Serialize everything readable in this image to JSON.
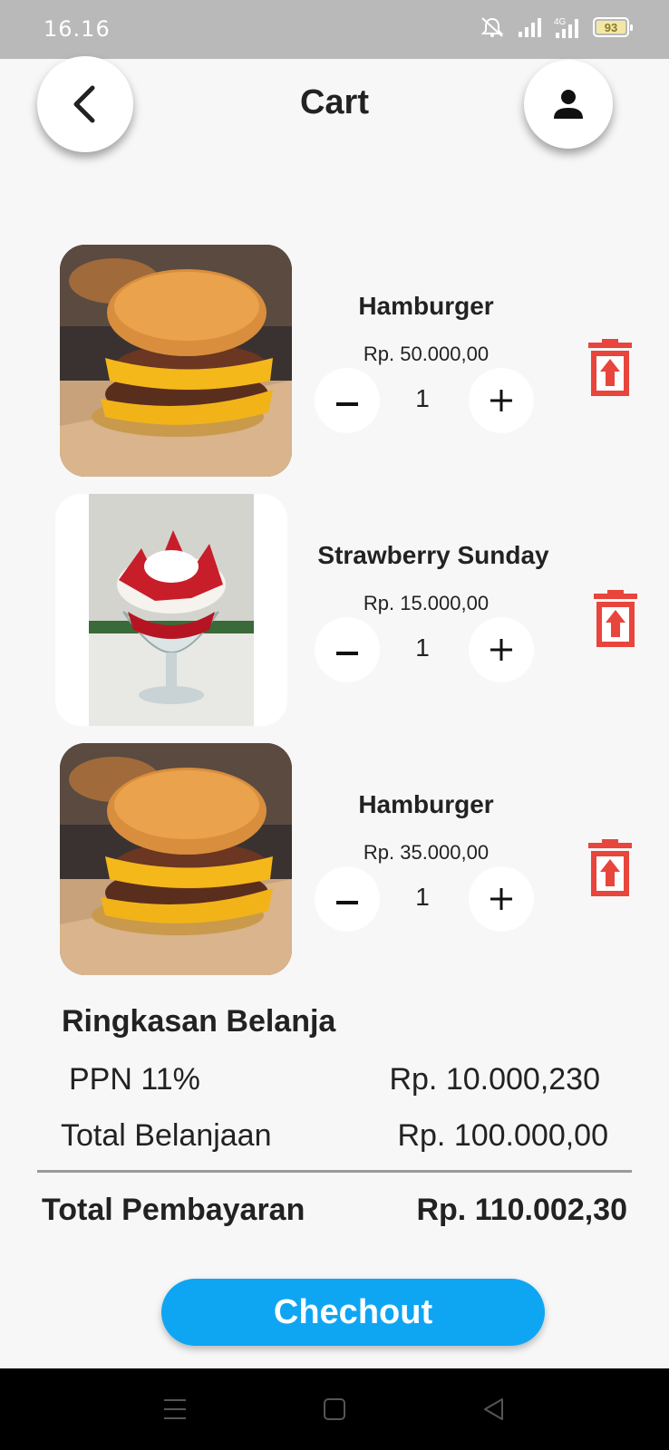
{
  "status_bar": {
    "time": "16.16",
    "battery_level": "93",
    "network": "4G"
  },
  "header": {
    "title": "Cart",
    "back_icon": "chevron-left-icon",
    "profile_icon": "person-icon"
  },
  "cart": {
    "items": [
      {
        "name": "Hamburger",
        "price": "Rp. 50.000,00",
        "qty": "1",
        "image": "hamburger-photo"
      },
      {
        "name": "Strawberry Sunday",
        "price": "Rp. 15.000,00",
        "qty": "1",
        "image": "strawberry-sundae-photo"
      },
      {
        "name": "Hamburger",
        "price": "Rp. 35.000,00",
        "qty": "1",
        "image": "hamburger-photo"
      }
    ],
    "minus_icon": "minus-icon",
    "plus_icon": "plus-icon",
    "delete_icon": "trash-icon"
  },
  "summary": {
    "title": "Ringkasan Belanja",
    "ppn_label": "PPN 11%",
    "ppn_value": "Rp. 10.000,230",
    "subtotal_label": "Total Belanjaan",
    "subtotal_value": "Rp. 100.000,00",
    "total_label": "Total Pembayaran",
    "total_value": "Rp. 110.002,30"
  },
  "checkout": {
    "label": "Chechout"
  },
  "colors": {
    "accent": "#0ea6f3",
    "delete": "#e8453c",
    "status_bar": "#b9b9b9"
  }
}
